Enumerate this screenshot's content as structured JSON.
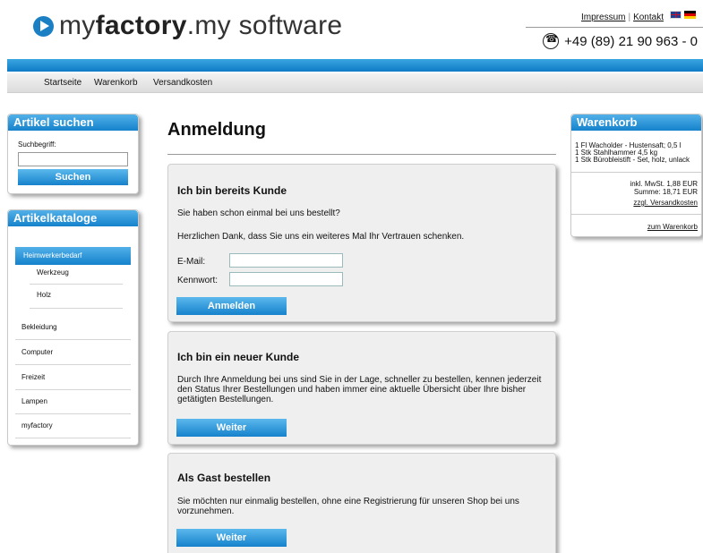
{
  "header": {
    "logo_prefix": "my",
    "logo_bold": "factory",
    "logo_suffix": ".my software",
    "links": [
      "Impressum",
      "Kontakt"
    ],
    "phone": "+49 (89) 21 90 963 - 0"
  },
  "nav": {
    "items": [
      "Startseite",
      "Warenkorb",
      "Versandkosten"
    ]
  },
  "search": {
    "title": "Artikel suchen",
    "label": "Suchbegriff:",
    "value": "",
    "button": "Suchen"
  },
  "catalogs": {
    "title": "Artikelkataloge",
    "active": "Heimwerkerbedarf",
    "subitems": [
      "Werkzeug",
      "Holz"
    ],
    "items": [
      "Bekleidung",
      "Computer",
      "Freizeit",
      "Lampen",
      "myfactory"
    ]
  },
  "main": {
    "title": "Anmeldung",
    "existing": {
      "heading": "Ich bin bereits Kunde",
      "text1": "Sie haben schon einmal bei uns bestellt?",
      "text2": "Herzlichen Dank, dass Sie uns ein weiteres Mal Ihr Vertrauen schenken.",
      "email_label": "E-Mail:",
      "password_label": "Kennwort:",
      "email_value": "",
      "password_value": "",
      "button": "Anmelden"
    },
    "new_customer": {
      "heading": "Ich bin ein neuer Kunde",
      "text": "Durch Ihre Anmeldung bei uns sind Sie in der Lage, schneller zu bestellen, kennen jederzeit den Status Ihrer Bestellungen und haben immer eine aktuelle Übersicht über Ihre bisher getätigten Bestellungen.",
      "button": "Weiter"
    },
    "guest": {
      "heading": "Als Gast bestellen",
      "text": "Sie möchten nur einmalig bestellen, ohne eine Registrierung für unseren Shop bei uns vorzunehmen.",
      "button": "Weiter"
    }
  },
  "cart": {
    "title": "Warenkorb",
    "items": [
      "1 Fl Wacholder - Hustensaft; 0,5 l",
      "1 Stk Stahlhammer 4,5 kg",
      "1 Stk Bürobleistift - Set, holz, unlack"
    ],
    "tax": "inkl. MwSt. 1,88 EUR",
    "sum": "Summe: 18,71 EUR",
    "shipping_link": "zzgl. Versandkosten",
    "cart_link": "zum Warenkorb"
  }
}
